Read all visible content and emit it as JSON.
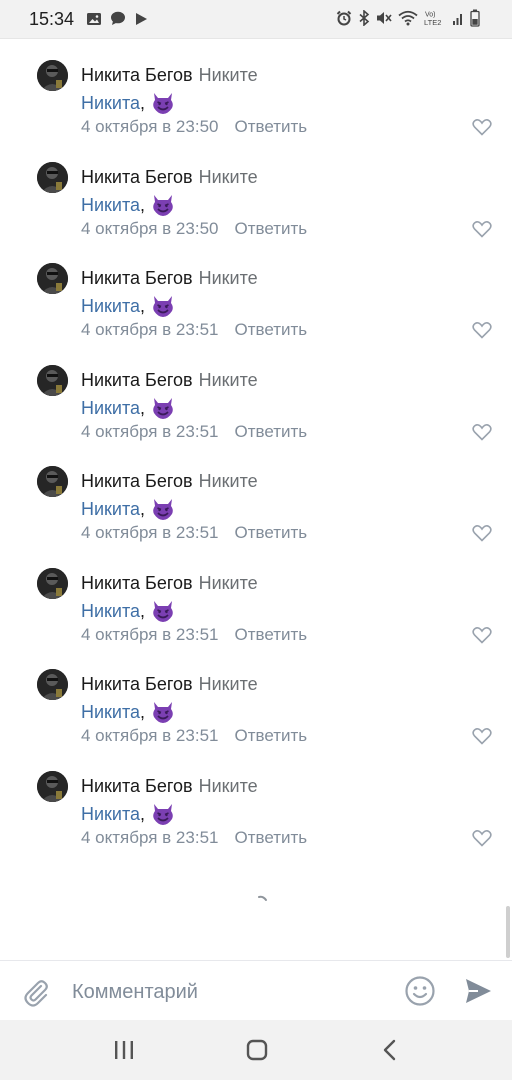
{
  "status_bar": {
    "time": "15:34",
    "left_icons": [
      "image-icon",
      "chat-bubble-icon",
      "play-icon"
    ],
    "right_icons": [
      "alarm-icon",
      "bluetooth-icon",
      "mute-icon",
      "wifi-icon",
      "volte-icon",
      "signal-icon",
      "battery-icon"
    ],
    "lte_label": "Vo)\nLTE2"
  },
  "comments": [
    {
      "author": "Никита Бегов",
      "reply_to": "Никите",
      "mention": "Никита",
      "comma": ",",
      "emoji": "smiling-imp-emoji",
      "date": "4 октября в 23:50",
      "reply_label": "Ответить"
    },
    {
      "author": "Никита Бегов",
      "reply_to": "Никите",
      "mention": "Никита",
      "comma": ",",
      "emoji": "smiling-imp-emoji",
      "date": "4 октября в 23:50",
      "reply_label": "Ответить"
    },
    {
      "author": "Никита Бегов",
      "reply_to": "Никите",
      "mention": "Никита",
      "comma": ",",
      "emoji": "smiling-imp-emoji",
      "date": "4 октября в 23:51",
      "reply_label": "Ответить"
    },
    {
      "author": "Никита Бегов",
      "reply_to": "Никите",
      "mention": "Никита",
      "comma": ",",
      "emoji": "smiling-imp-emoji",
      "date": "4 октября в 23:51",
      "reply_label": "Ответить"
    },
    {
      "author": "Никита Бегов",
      "reply_to": "Никите",
      "mention": "Никита",
      "comma": ",",
      "emoji": "smiling-imp-emoji",
      "date": "4 октября в 23:51",
      "reply_label": "Ответить"
    },
    {
      "author": "Никита Бегов",
      "reply_to": "Никите",
      "mention": "Никита",
      "comma": ",",
      "emoji": "smiling-imp-emoji",
      "date": "4 октября в 23:51",
      "reply_label": "Ответить"
    },
    {
      "author": "Никита Бегов",
      "reply_to": "Никите",
      "mention": "Никита",
      "comma": ",",
      "emoji": "smiling-imp-emoji",
      "date": "4 октября в 23:51",
      "reply_label": "Ответить"
    },
    {
      "author": "Никита Бегов",
      "reply_to": "Никите",
      "mention": "Никита",
      "comma": ",",
      "emoji": "smiling-imp-emoji",
      "date": "4 октября в 23:51",
      "reply_label": "Ответить"
    }
  ],
  "composer": {
    "placeholder": "Комментарий",
    "value": "",
    "attach_icon": "paperclip-icon",
    "emoji_icon": "smile-icon",
    "send_icon": "send-icon"
  },
  "nav_bar": {
    "icons": [
      "recent-apps-icon",
      "home-icon",
      "back-icon"
    ]
  },
  "colors": {
    "mention": "#3f6fa6",
    "meta": "#818c99",
    "emoji": "#7b3fb2",
    "send": "#818c99"
  }
}
